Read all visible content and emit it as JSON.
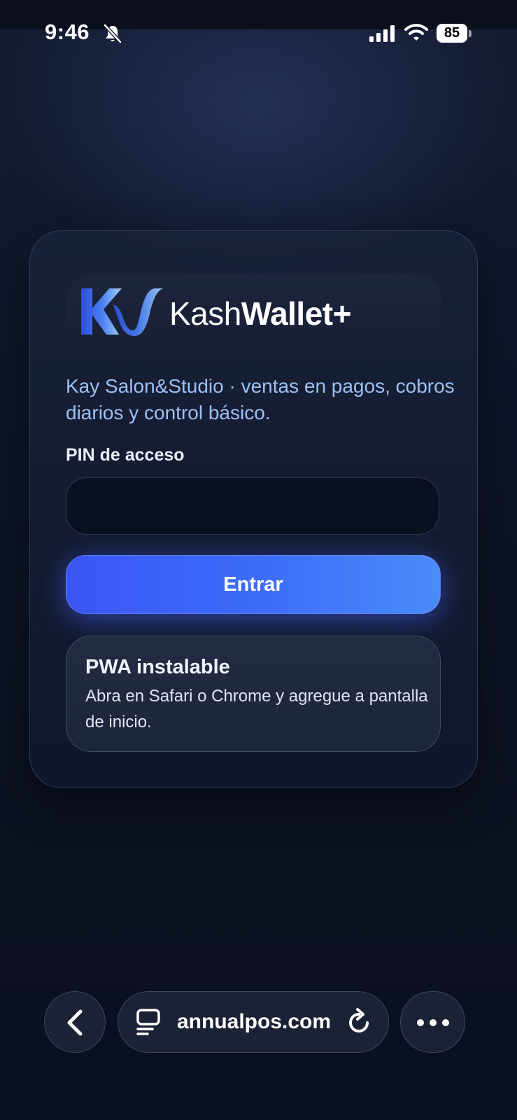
{
  "status_bar": {
    "time": "9:46",
    "battery_level": "85",
    "icons": [
      "bell-slash-icon",
      "cellular-signal-icon",
      "wifi-icon",
      "battery-icon"
    ]
  },
  "login_card": {
    "logo_icon": "kw-logo-icon",
    "brand_light": "Kash",
    "brand_bold": "Wallet+",
    "subtitle": "Kay Salon&Studio · ventas en pagos, cobros diarios y control básico.",
    "pin_label": "PIN de acceso",
    "pin_value": "",
    "enter_label": "Entrar",
    "pwa_title": "PWA instalable",
    "pwa_text": "Abra en Safari o Chrome y agregue a pantalla de inicio."
  },
  "browser": {
    "url": "annualpos.com",
    "icons": [
      "back-arrow-icon",
      "tabs-icon",
      "reload-icon",
      "more-icon"
    ]
  },
  "colors": {
    "accent": "#3d6ef9",
    "background": "#0b1020",
    "subtitle": "#9cc0f2"
  }
}
